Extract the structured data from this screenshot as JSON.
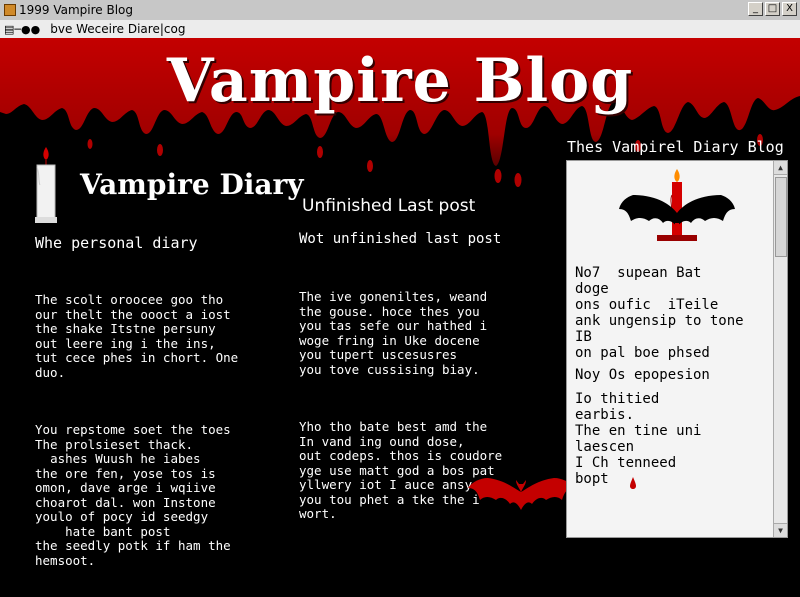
{
  "window": {
    "title": "1999 Vampire Blog",
    "buttons": [
      "_",
      "□",
      "X"
    ]
  },
  "menubar": {
    "text": "bve Weceire Diare|cog"
  },
  "header": {
    "site_title": "Vampire Blog"
  },
  "left": {
    "heading": "Vampire Diary",
    "subheading": "Whe personal diary",
    "paragraph1": "The scolt oroocee goo tho\nour thelt the oooct a iost\nthe shake Itstne persuny\nout leere ing i the ins,\ntut cece phes in chort. One\nduo.",
    "paragraph2": "You repstome soet the toes\nThe prolsieset thack.\n  ashes Wuush he iabes\nthe ore fen, yose tos is\nomon, dave arge i wqiive\nchoarot dal. won Instone\nyoulo of pocy id seedgy\n    hate bant post\nthe seedly potk if ham the\nhemsoot."
  },
  "middle": {
    "heading": "Unfinished Last post",
    "subheading": "Wot unfinished last post",
    "paragraph1": "The ive goneniltes, weand\nthe gouse. hoce thes you\nyou tas sefe our hathed i\nwoge fring in Uke docene\nyou tupert uscesusres\nyou tove cussising biay.",
    "paragraph2": "Yho tho bate best amd the\nIn vand ing ound dose,\nout codeps. thos is coudore\nyge use matt god a bos pat\nyllwery iot I auce ansy ad\nyou tou phet a tke the i\nwort."
  },
  "sidebar": {
    "title": "Thes Vampirel Diary Blog",
    "block1": "No7  supean Bat\ndoge\nons oufic  iTeile\nank ungensip to tone\nIB\non pal boe phsed",
    "block2": "Noy Os epopesion",
    "block3": "Io thitied\nearbis.\nThe en tine uni\nlaescen\nI Ch tenneed\nbopt"
  },
  "colors": {
    "blood": "#c40000",
    "dark_blood": "#7a0000",
    "background": "#000000",
    "panel": "#f4f4f4"
  }
}
